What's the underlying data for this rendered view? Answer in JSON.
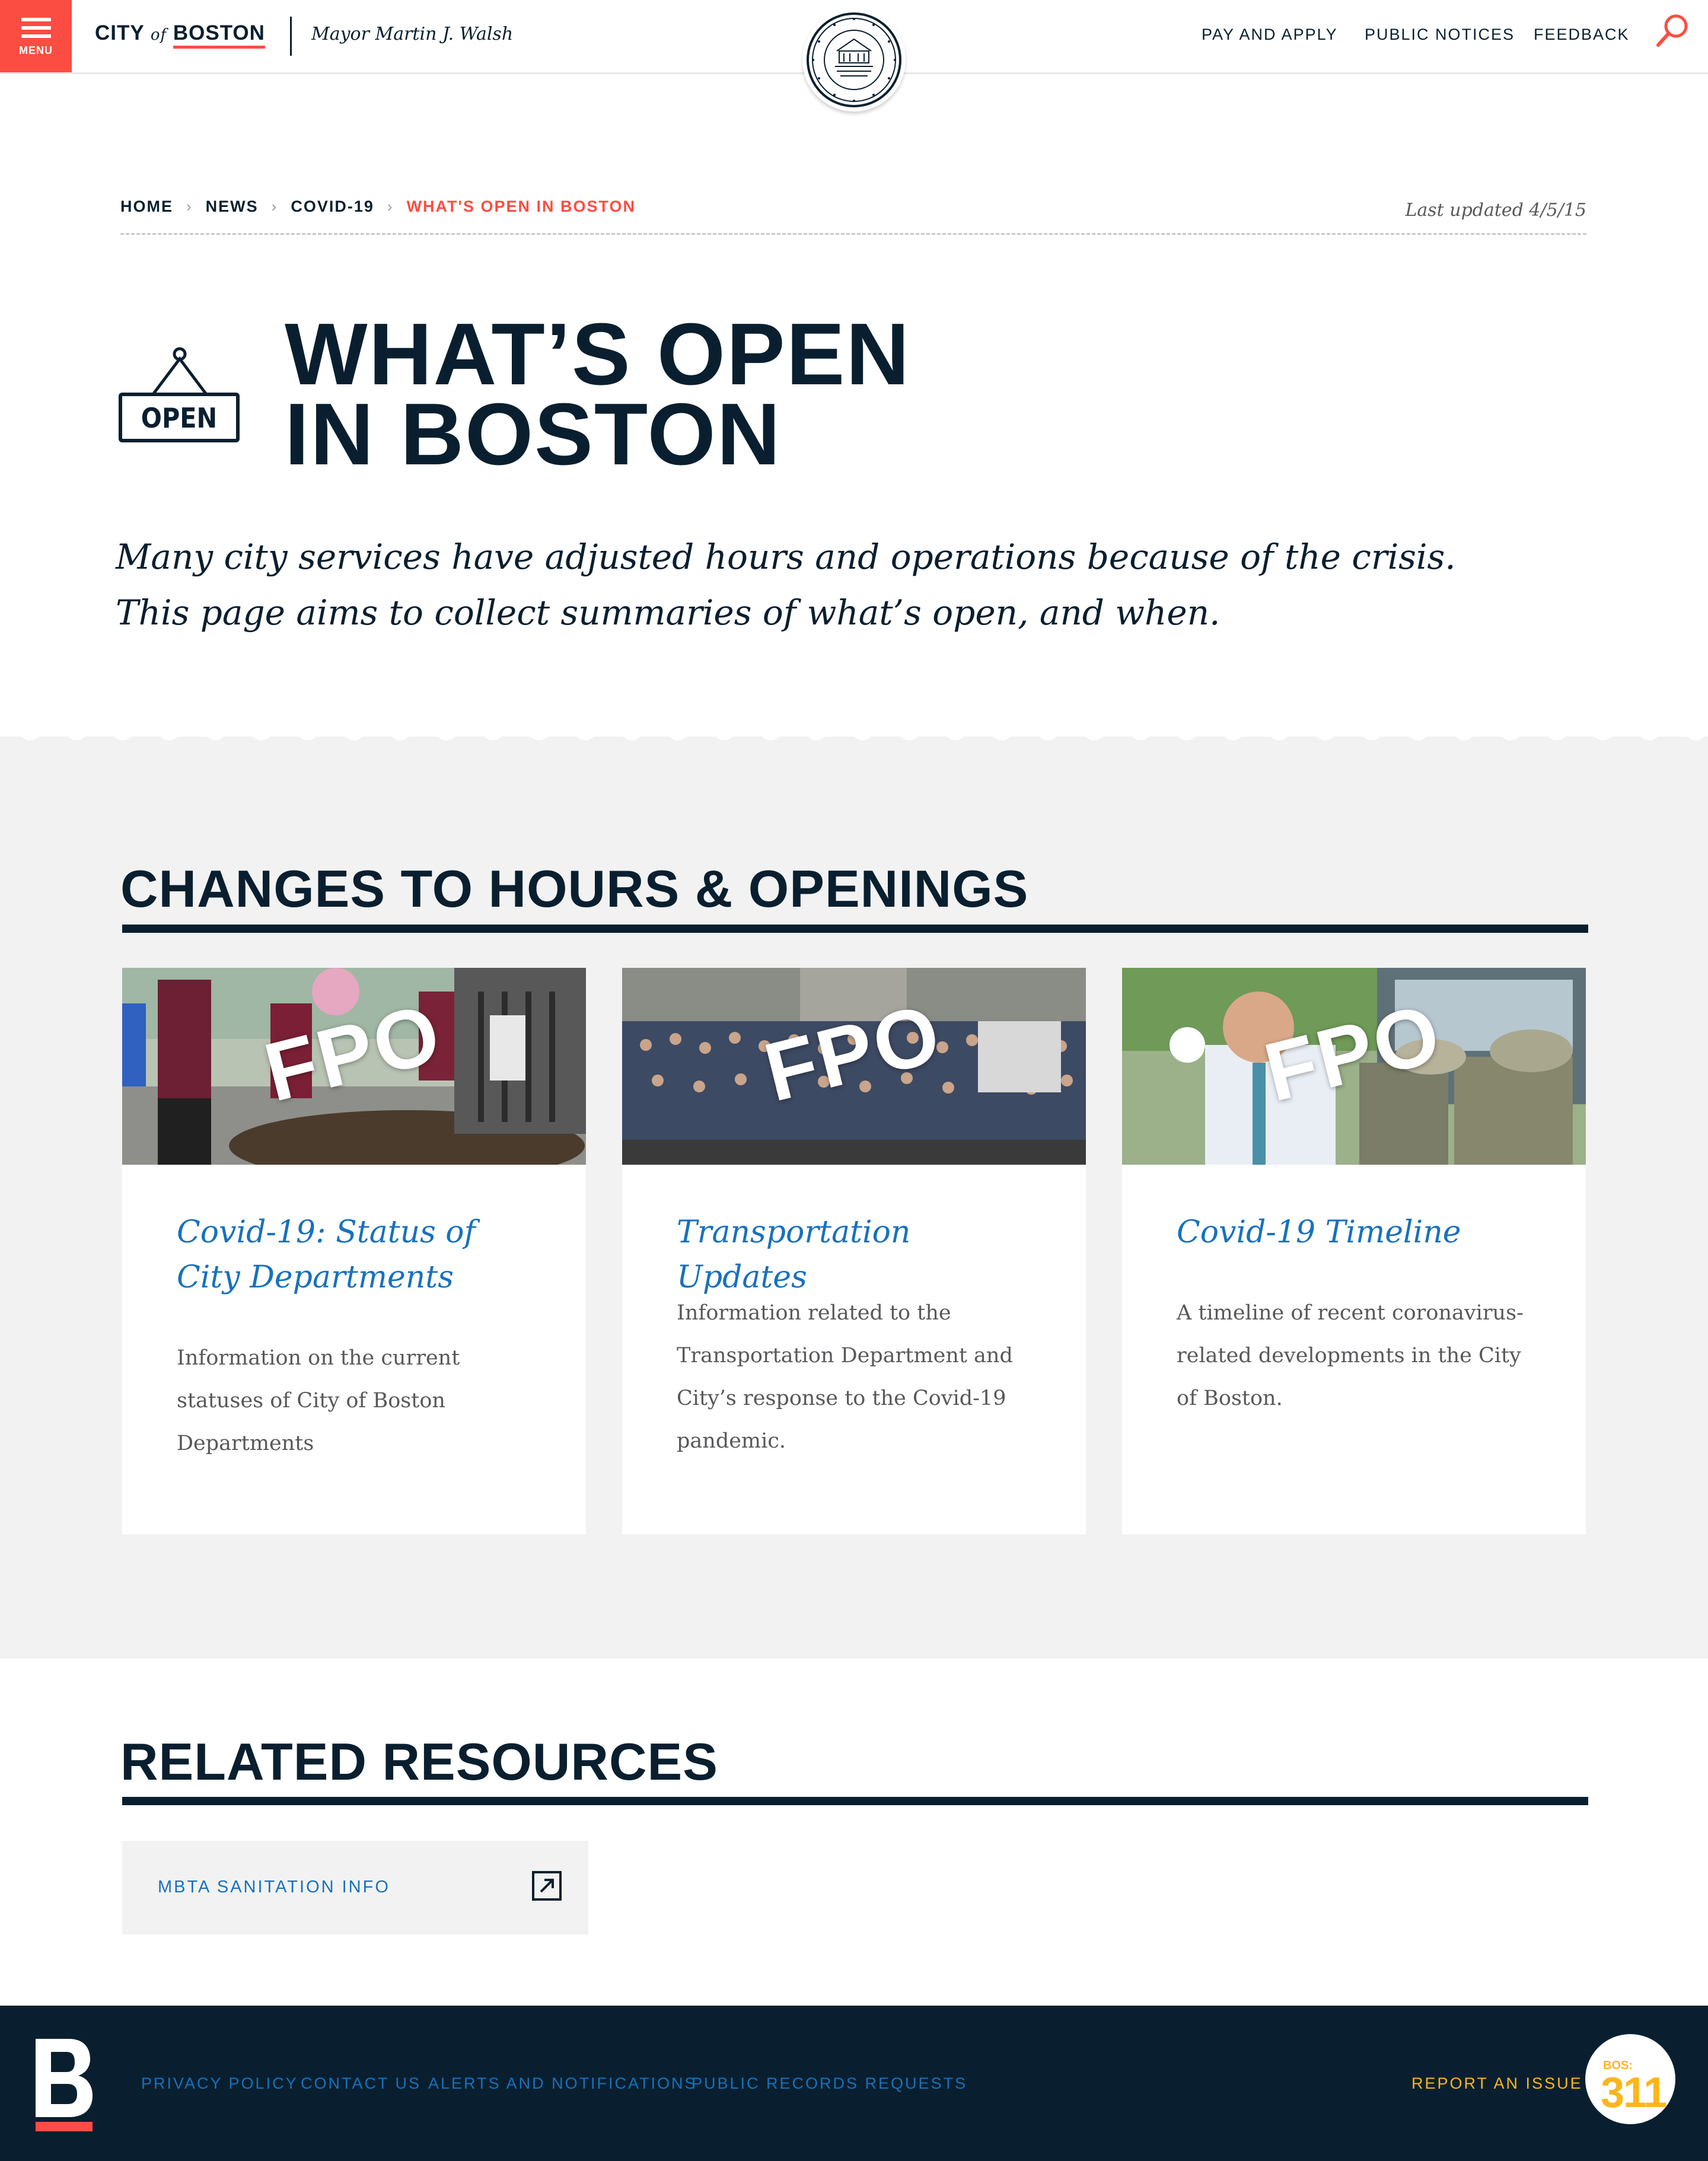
{
  "header": {
    "menu_label": "MENU",
    "logo_city": "CITY",
    "logo_of": "of",
    "logo_boston": "BOSTON",
    "mayor": "Mayor Martin J. Walsh",
    "nav": [
      "PAY AND APPLY",
      "PUBLIC NOTICES",
      "FEEDBACK"
    ]
  },
  "breadcrumb": {
    "items": [
      "HOME",
      "NEWS",
      "COVID-19",
      "WHAT'S OPEN IN BOSTON"
    ],
    "last_updated": "Last updated 4/5/15"
  },
  "hero": {
    "icon_text": "OPEN",
    "title_line1": "WHAT’S OPEN",
    "title_line2": "IN BOSTON",
    "intro_line1": "Many city services have adjusted hours and operations because of the crisis.",
    "intro_line2": "This page aims to collect summaries of what’s open, and when."
  },
  "changes": {
    "heading": "CHANGES TO HOURS & OPENINGS",
    "cards": [
      {
        "image_overlay": "FPO",
        "title": "Covid-19: Status of City Departments",
        "description": "Information on the current statuses of City of Boston Departments"
      },
      {
        "image_overlay": "FPO",
        "title": "Transportation Updates",
        "description": "Information related to the Transportation Department and City’s response to the Covid-19 pandemic."
      },
      {
        "image_overlay": "FPO",
        "title": "Covid-19 Timeline",
        "description": "A timeline of recent coronavirus-related developments in the City of Boston."
      }
    ]
  },
  "related": {
    "heading": "RELATED RESOURCES",
    "items": [
      {
        "label": "MBTA SANITATION INFO",
        "icon": "external-link-icon"
      }
    ]
  },
  "footer": {
    "links": [
      "PRIVACY POLICY",
      "CONTACT US",
      "ALERTS AND NOTIFICATIONS",
      "PUBLIC RECORDS REQUESTS"
    ],
    "report": "REPORT AN ISSUE",
    "bos311_small": "BOS:",
    "bos311_big": "311"
  },
  "colors": {
    "accent_red": "#fb4d42",
    "navy": "#091f2f",
    "link_blue": "#1871bd",
    "optimistic_yellow": "#fcb61a",
    "light_gray": "#f2f2f2"
  }
}
